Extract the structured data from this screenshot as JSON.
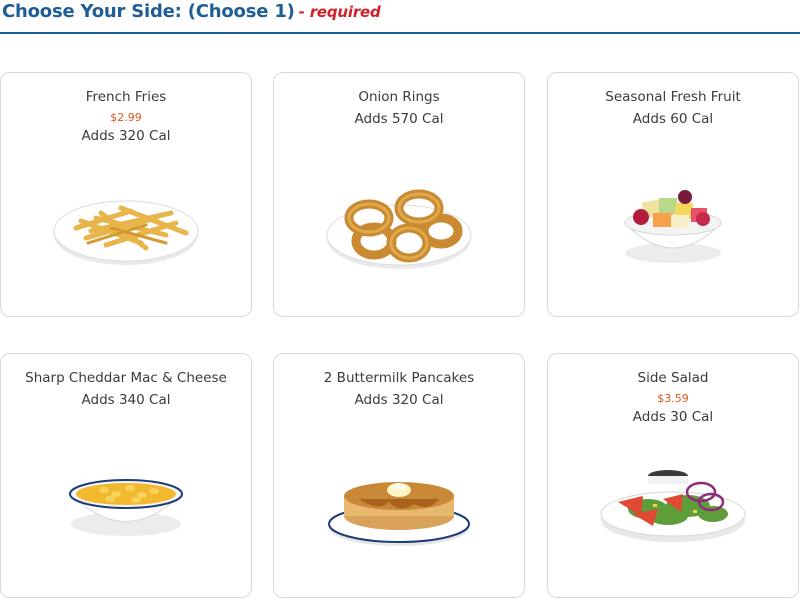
{
  "header": {
    "title": "Choose Your Side: (Choose 1)",
    "required": "- required"
  },
  "sides": [
    {
      "name": "French Fries",
      "price": "$2.99",
      "calories": "Adds 320 Cal",
      "icon": "french-fries-plate"
    },
    {
      "name": "Onion Rings",
      "calories": "Adds 570 Cal",
      "icon": "onion-rings-plate"
    },
    {
      "name": "Seasonal Fresh Fruit",
      "calories": "Adds 60 Cal",
      "icon": "fruit-bowl"
    },
    {
      "name": "Sharp Cheddar Mac & Cheese",
      "calories": "Adds 340 Cal",
      "icon": "mac-and-cheese-bowl"
    },
    {
      "name": "2 Buttermilk Pancakes",
      "calories": "Adds 320 Cal",
      "icon": "pancakes-plate"
    },
    {
      "name": "Side Salad",
      "price": "$3.59",
      "calories": "Adds 30 Cal",
      "icon": "side-salad-plate"
    }
  ],
  "colors": {
    "title": "#1f5d96",
    "required": "#d21f2a",
    "price": "#e0581f",
    "border": "#d9d9d9"
  }
}
